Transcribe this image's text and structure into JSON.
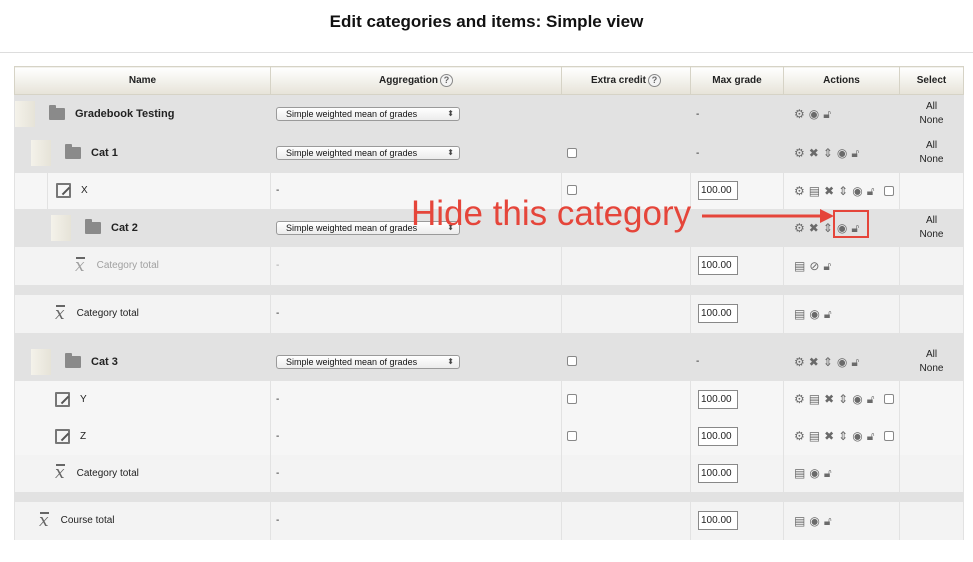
{
  "page": {
    "title": "Edit categories and items: Simple view"
  },
  "headers": {
    "name": "Name",
    "aggregation": "Aggregation",
    "extra_credit": "Extra credit",
    "max_grade": "Max grade",
    "actions": "Actions",
    "select": "Select"
  },
  "aggregation_option": "Simple weighted mean of grades",
  "dash": "-",
  "select_links": {
    "all": "All",
    "none": "None"
  },
  "rows": {
    "gradebook": {
      "name": "Gradebook Testing",
      "max_grade": "-"
    },
    "cat1": {
      "name": "Cat 1",
      "max_grade": "-"
    },
    "x": {
      "name": "X",
      "max_grade": "100.00"
    },
    "cat2": {
      "name": "Cat 2"
    },
    "cat2_total": {
      "name": "Category total",
      "max_grade": "100.00"
    },
    "cat1_total": {
      "name": "Category total",
      "max_grade": "100.00"
    },
    "cat3": {
      "name": "Cat 3",
      "max_grade": "-"
    },
    "y": {
      "name": "Y",
      "max_grade": "100.00"
    },
    "z": {
      "name": "Z",
      "max_grade": "100.00"
    },
    "cat3_total": {
      "name": "Category total",
      "max_grade": "100.00"
    },
    "course_total": {
      "name": "Course total",
      "max_grade": "100.00"
    }
  },
  "annotation": {
    "text": "Hide this category",
    "color": "#e5453a"
  },
  "icons": {
    "edit": "gear-icon",
    "delete": "close-icon",
    "move": "move-icon",
    "show": "eye-icon",
    "lock": "lock-icon",
    "grader": "grader-report-icon"
  }
}
